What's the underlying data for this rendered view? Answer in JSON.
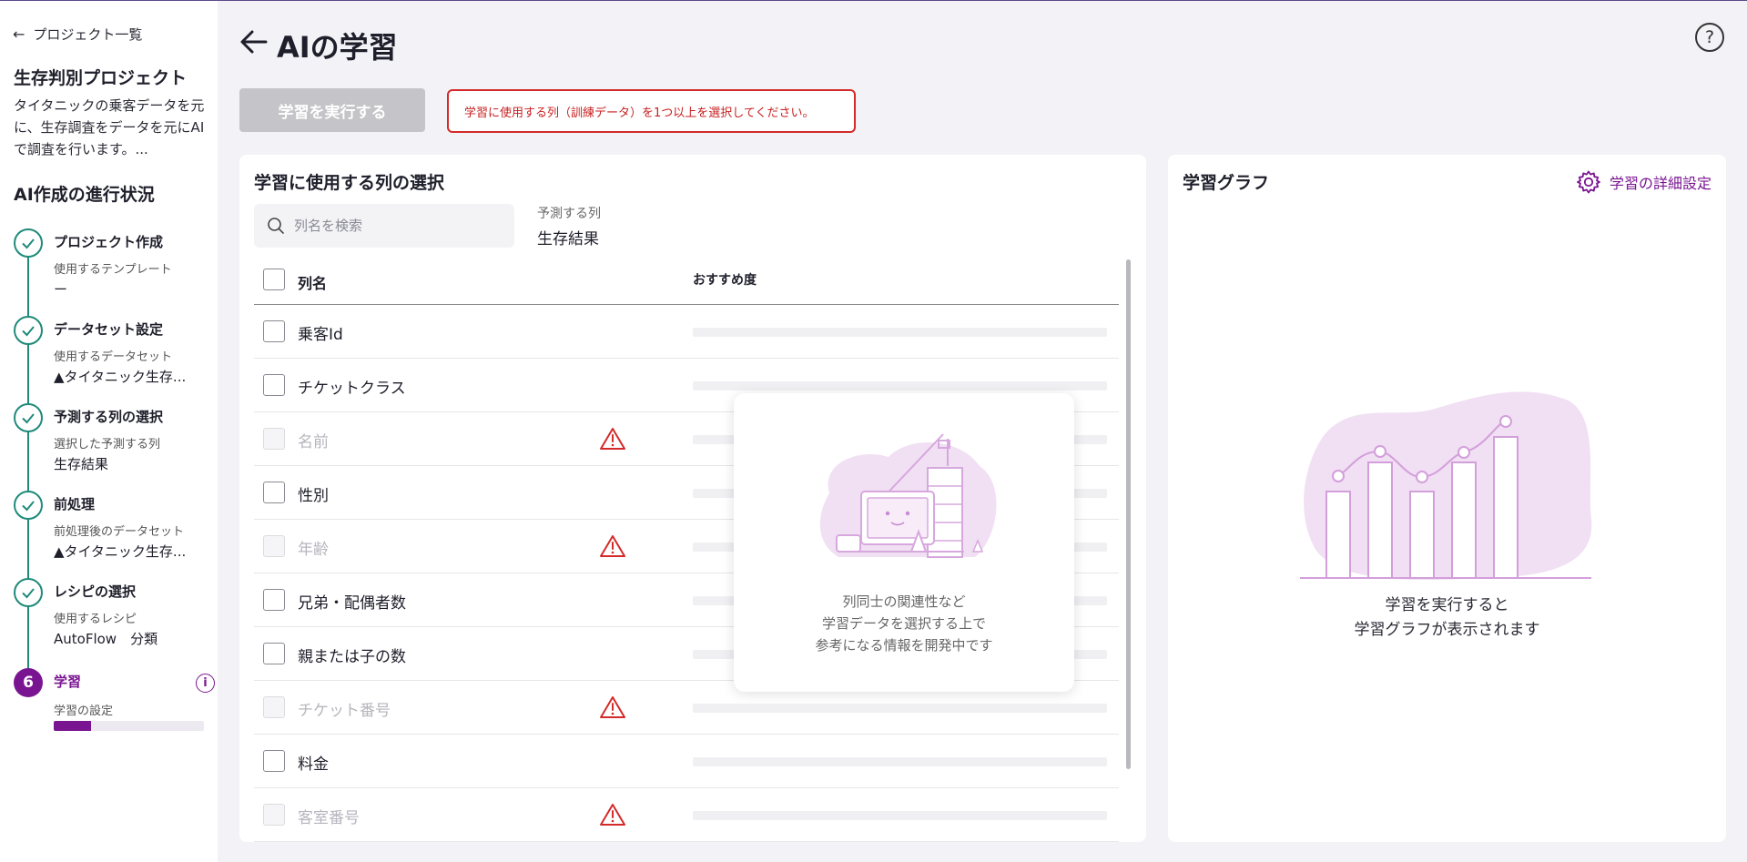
{
  "sidebar": {
    "back_label": "プロジェクト一覧",
    "project_title": "生存判別プロジェクト",
    "project_description": "タイタニックの乗客データを元に、生存調査をデータを元にAIで調査を行います。...",
    "progress_title": "AI作成の進行状況",
    "steps": [
      {
        "number": "1",
        "title": "プロジェクト作成",
        "sub": "使用するテンプレート",
        "value": "ー"
      },
      {
        "number": "2",
        "title": "データセット設定",
        "sub": "使用するデータセット",
        "value": "▲タイタニック生存..."
      },
      {
        "number": "3",
        "title": "予測する列の選択",
        "sub": "選択した予測する列",
        "value": "生存結果"
      },
      {
        "number": "4",
        "title": "前処理",
        "sub": "前処理後のデータセット",
        "value": "▲タイタニック生存..."
      },
      {
        "number": "5",
        "title": "レシピの選択",
        "sub": "使用するレシピ",
        "value": "AutoFlow　分類"
      },
      {
        "number": "6",
        "title": "学習",
        "sub": "学習の設定",
        "progress": 0.25
      }
    ]
  },
  "header": {
    "title": "AIの学習",
    "help_symbol": "?"
  },
  "toolbar": {
    "run_label": "学習を実行する",
    "error_message": "学習に使用する列（訓練データ）を1つ以上を選択してください。"
  },
  "column_panel": {
    "title": "学習に使用する列の選択",
    "search_placeholder": "列名を検索",
    "target_label": "予測する列",
    "target_value": "生存結果",
    "header_name": "列名",
    "header_recommend": "おすすめ度",
    "rows": [
      {
        "name": "乗客Id",
        "disabled": false,
        "warning": false
      },
      {
        "name": "チケットクラス",
        "disabled": false,
        "warning": false
      },
      {
        "name": "名前",
        "disabled": true,
        "warning": true
      },
      {
        "name": "性別",
        "disabled": false,
        "warning": false
      },
      {
        "name": "年齢",
        "disabled": true,
        "warning": true
      },
      {
        "name": "兄弟・配偶者数",
        "disabled": false,
        "warning": false
      },
      {
        "name": "親または子の数",
        "disabled": false,
        "warning": false
      },
      {
        "name": "チケット番号",
        "disabled": true,
        "warning": true
      },
      {
        "name": "料金",
        "disabled": false,
        "warning": false
      },
      {
        "name": "客室番号",
        "disabled": true,
        "warning": true
      }
    ],
    "overlay_text": [
      "列同士の関連性など",
      "学習データを選択する上で",
      "参考になる情報を開発中です"
    ]
  },
  "graph_panel": {
    "title": "学習グラフ",
    "settings_label": "学習の詳細設定",
    "empty_text": [
      "学習を実行すると",
      "学習グラフが表示されます"
    ]
  },
  "colors": {
    "accent": "#7a1592",
    "step_done": "#1f8a7a",
    "error": "#d42a2a"
  }
}
